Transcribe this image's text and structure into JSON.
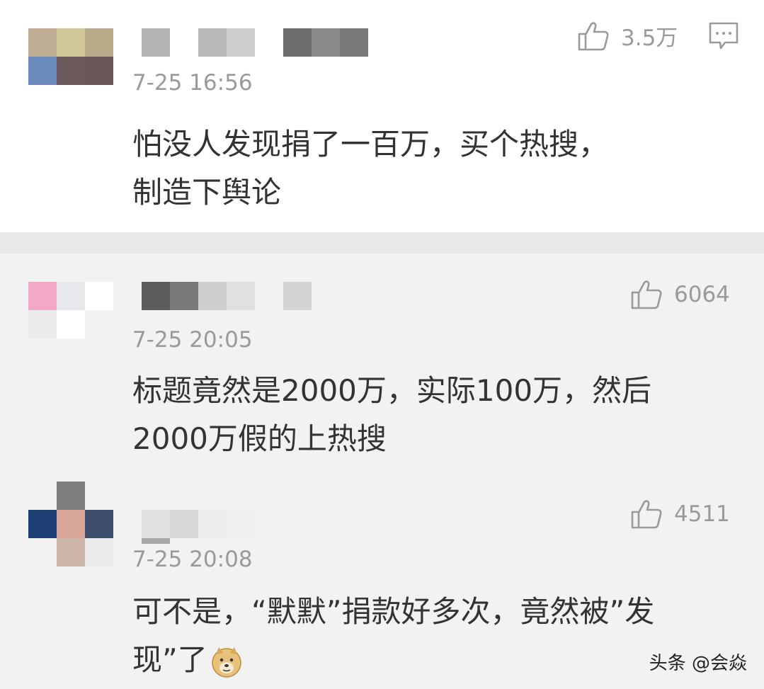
{
  "colors": {
    "card_bg": "#ffffff",
    "list_bg": "#f2f2f2",
    "meta_gray": "#9a9a9a",
    "text": "#333333"
  },
  "comments": [
    {
      "time": "7-25 16:56",
      "text_line1": "怕没人发现捐了一百万，买个热搜，",
      "text_line2": "制造下舆论",
      "likes": "3.5万",
      "icons": [
        "thumbs-up-icon",
        "reply-icon"
      ],
      "avatar_pixels": [
        "#bfae93",
        "#cfc99a",
        "#b8a988",
        "#6c8cbd",
        "#6d5a5c",
        "#6b5658"
      ]
    },
    {
      "time": "7-25 20:05",
      "text_line1": "标题竟然是2000万，实际100万，然后",
      "text_line2": "2000万假的上热搜",
      "likes": "6064",
      "icons": [
        "thumbs-up-icon"
      ],
      "avatar_pixels": [
        "#f2a9c8",
        "#e8e8ec",
        "#ffffff",
        "#ebebeb",
        "#ffffff",
        "#f2f2f2"
      ]
    },
    {
      "time": "7-25 20:08",
      "text_line1": "可不是，“默默”捐款好多次，竟然被”发",
      "text_line2": "现”了",
      "likes": "4511",
      "icons": [
        "thumbs-up-icon",
        "doge-emoji-icon"
      ]
    }
  ],
  "watermark": "头条 @会焱"
}
